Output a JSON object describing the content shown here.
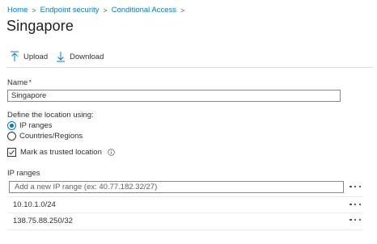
{
  "breadcrumb": {
    "items": [
      "Home",
      "Endpoint security",
      "Conditional Access"
    ],
    "separator": ">"
  },
  "page": {
    "title": "Singapore"
  },
  "toolbar": {
    "upload_label": "Upload",
    "download_label": "Download"
  },
  "form": {
    "name_label": "Name",
    "required_marker": "*",
    "name_value": "Singapore",
    "define_label": "Define the location using:",
    "options": [
      "IP ranges",
      "Countries/Regions"
    ],
    "selected_option": "IP ranges",
    "trusted_label": "Mark as trusted location",
    "trusted_checked": true,
    "ip_ranges_label": "IP ranges",
    "ip_placeholder": "Add a new IP range (ex: 40.77.182.32/27)",
    "ip_ranges": [
      "10.10.1.0/24",
      "138.75.88.250/32"
    ]
  },
  "colors": {
    "link": "#0078d4",
    "required": "#a4262c",
    "accent": "#0078d4"
  },
  "icons": [
    "chevron-right-icon",
    "upload-icon",
    "download-icon",
    "checkmark-icon",
    "info-icon",
    "more-icon"
  ]
}
